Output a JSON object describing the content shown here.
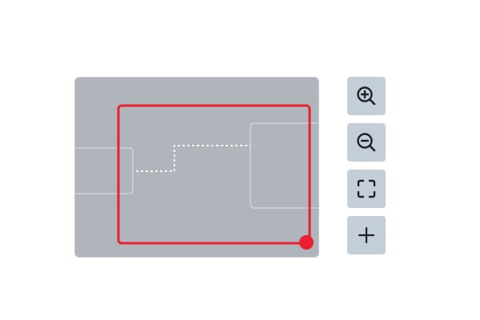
{
  "minimap": {
    "viewport_color": "#e8202f",
    "background_color": "#afb5bb",
    "node_stroke_color": "#cfd4d8",
    "edge_color": "#f2f4f5"
  },
  "controls": [
    {
      "name": "zoom-in",
      "icon": "zoom-in-icon"
    },
    {
      "name": "zoom-out",
      "icon": "zoom-out-icon"
    },
    {
      "name": "fit-view",
      "icon": "fit-view-icon"
    },
    {
      "name": "add",
      "icon": "plus-icon"
    }
  ],
  "colors": {
    "button_bg": "#c3ced8",
    "icon_color": "#1e2226"
  }
}
